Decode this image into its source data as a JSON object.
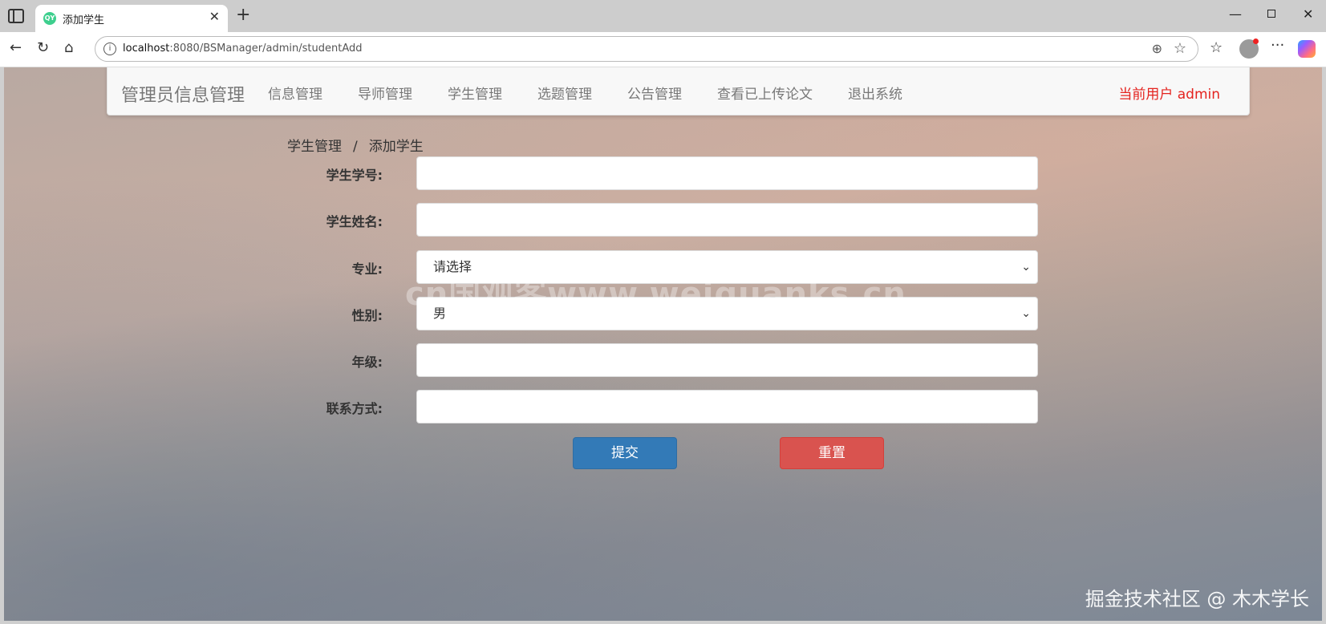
{
  "browser": {
    "tab_title": "添加学生",
    "tab_favicon_text": "QY",
    "url_host": "localhost",
    "url_rest": ":8080/BSManager/admin/studentAdd"
  },
  "topnav": {
    "brand": "管理员信息管理",
    "items": [
      "信息管理",
      "导师管理",
      "学生管理",
      "选题管理",
      "公告管理",
      "查看已上传论文",
      "退出系统"
    ],
    "current_user": "当前用户 admin"
  },
  "breadcrumb": {
    "parent": "学生管理",
    "separator": "/",
    "current": "添加学生"
  },
  "form": {
    "student_no_label": "学生学号:",
    "student_no_value": "",
    "student_name_label": "学生姓名:",
    "student_name_value": "",
    "major_label": "专业:",
    "major_selected": "请选择",
    "gender_label": "性别:",
    "gender_selected": "男",
    "grade_label": "年级:",
    "grade_value": "",
    "contact_label": "联系方式:",
    "contact_value": "",
    "submit_label": "提交",
    "reset_label": "重置"
  },
  "watermarks": {
    "center": "cn国观客www.weiguanks.cn",
    "corner": "掘金技术社区 @ 木木学长"
  },
  "colors": {
    "primary": "#337ab7",
    "danger": "#d9534f",
    "current_user": "#e4231f"
  }
}
